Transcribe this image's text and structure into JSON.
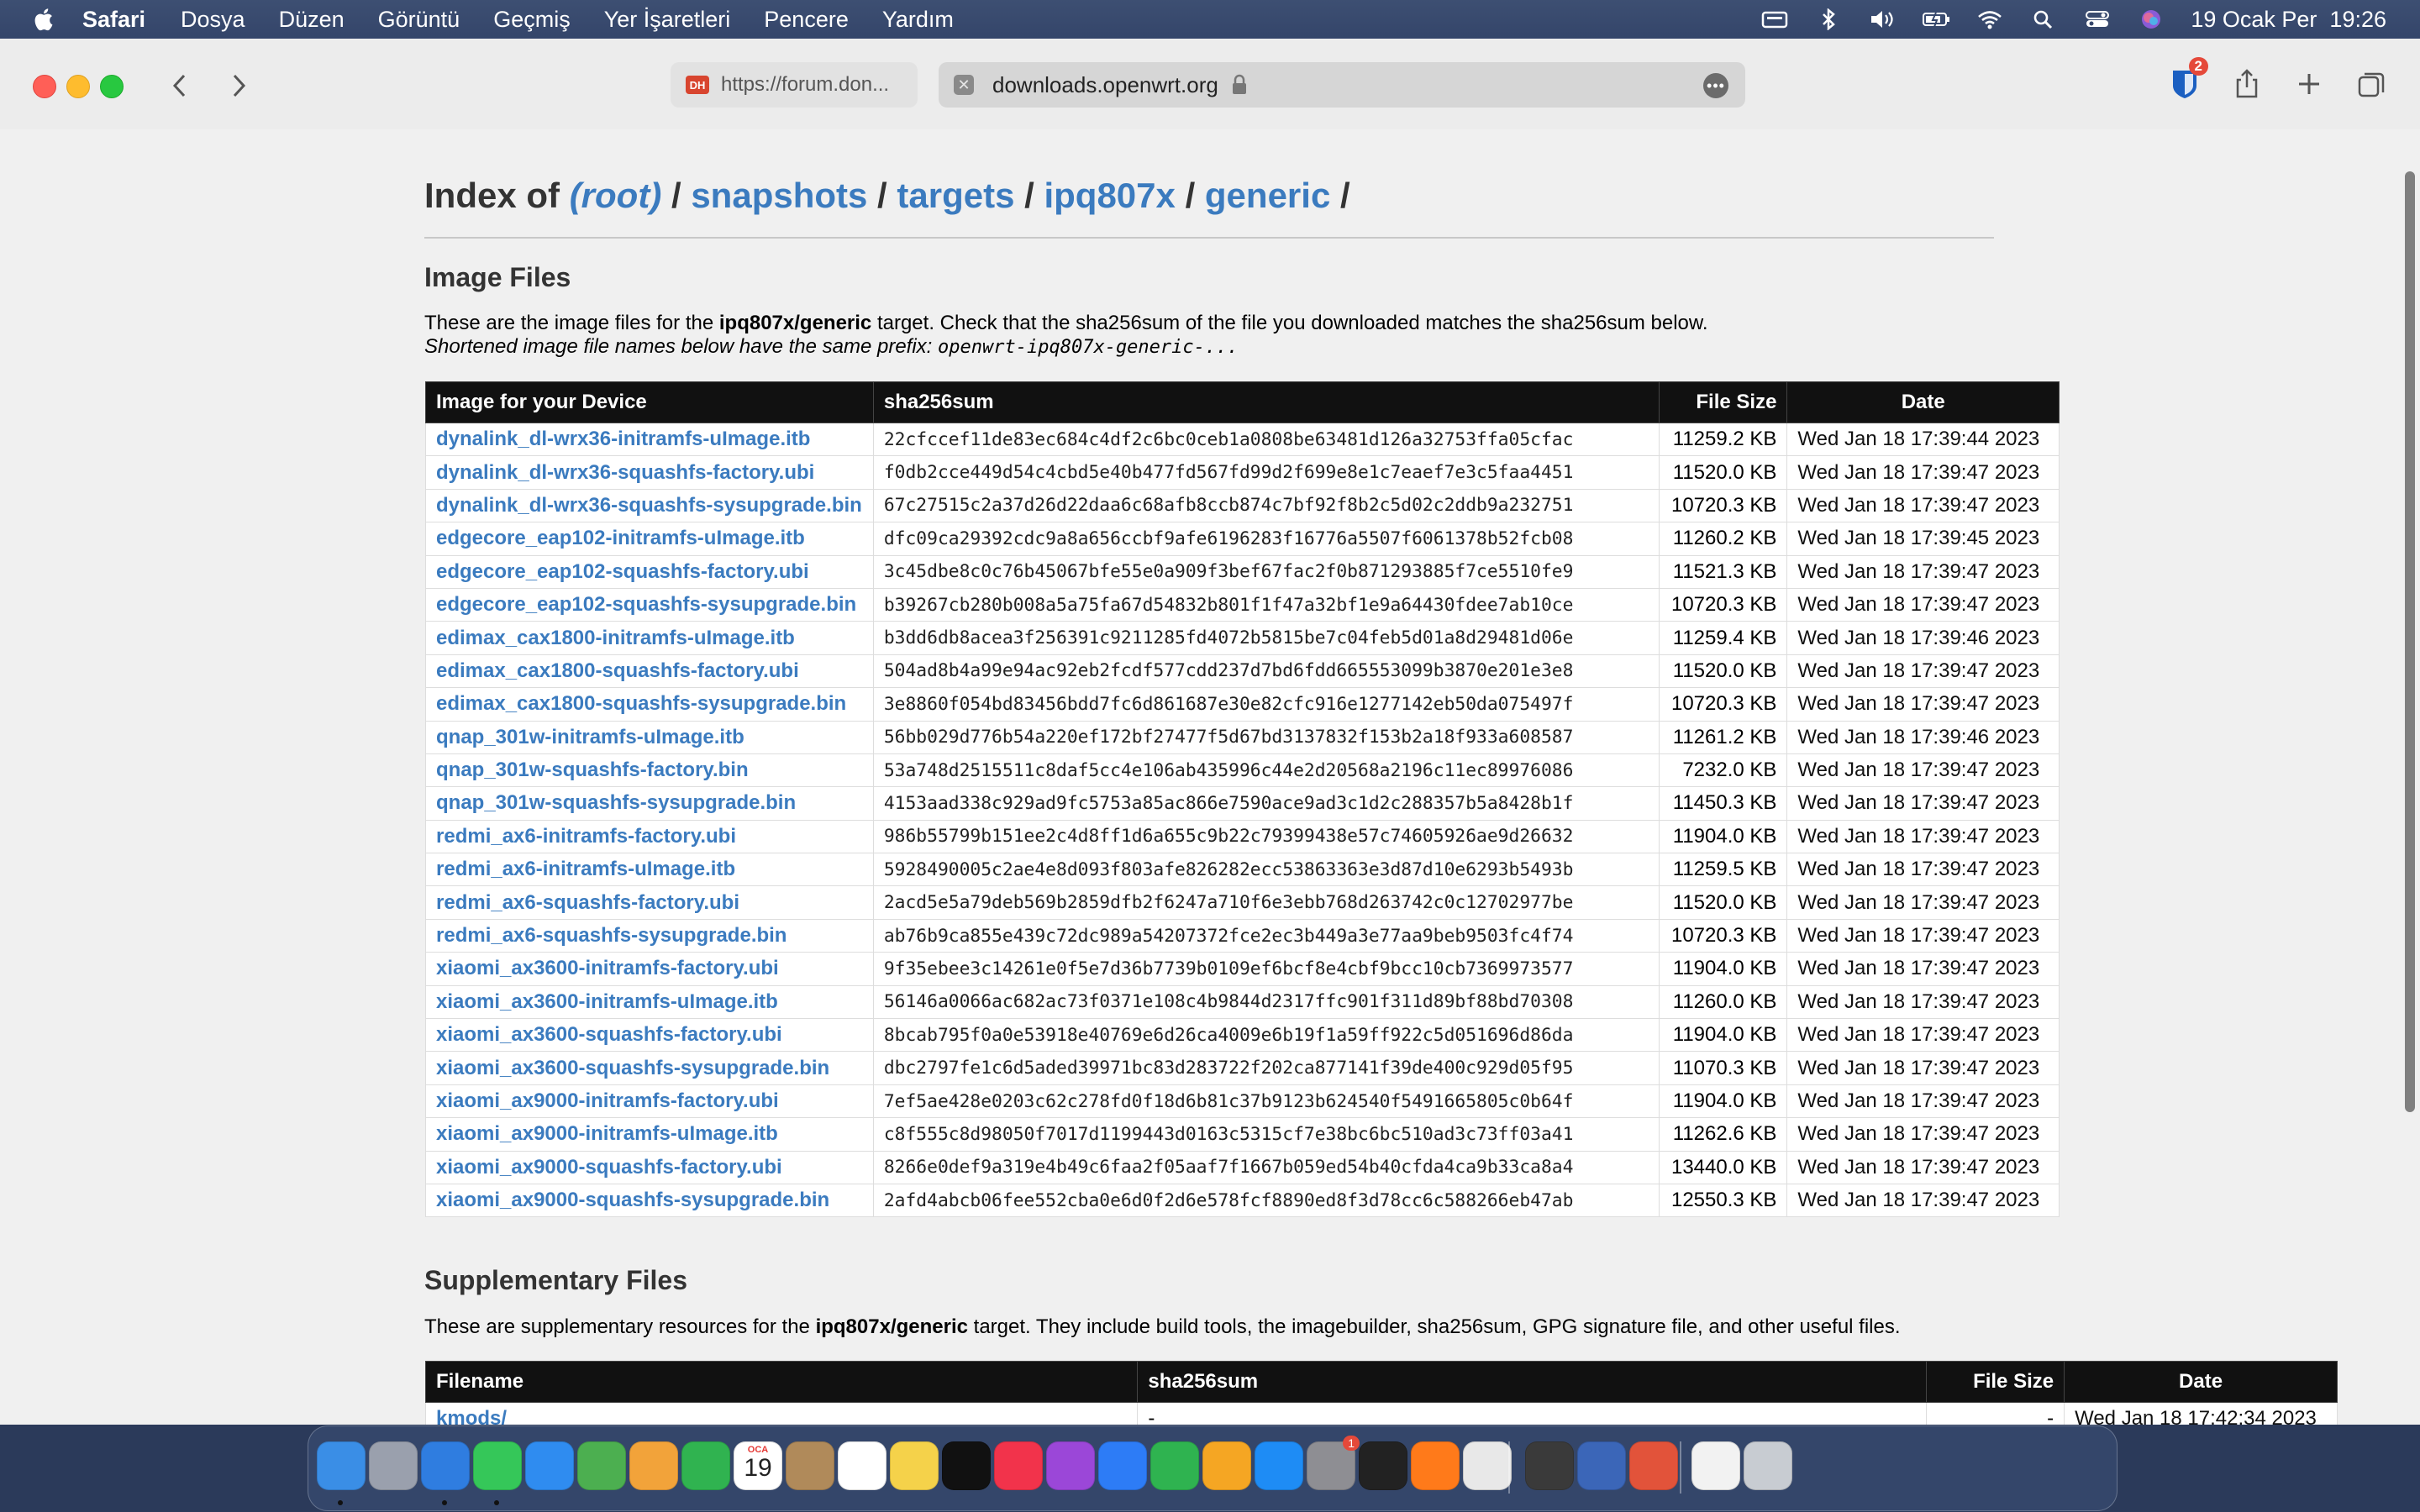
{
  "menubar": {
    "app": "Safari",
    "items": [
      "Dosya",
      "Düzen",
      "Görüntü",
      "Geçmiş",
      "Yer İşaretleri",
      "Pencere",
      "Yardım"
    ],
    "datetime": "19 Ocak Per  19:26",
    "status_icons": [
      "keyboard-icon",
      "bluetooth-icon",
      "volume-icon",
      "battery-icon",
      "wifi-icon",
      "spotlight-icon",
      "control-center-icon",
      "siri-icon"
    ]
  },
  "toolbar": {
    "tab1_favicon": "DH",
    "tab1_url": "https://forum.don...",
    "tab2_url": "downloads.openwrt.org",
    "tab2_close": "✕",
    "tab2_more": "•••",
    "bitwarden_badge": "2"
  },
  "page": {
    "index_of": "Index of",
    "crumbs": [
      "(root)",
      "snapshots",
      "targets",
      "ipq807x",
      "generic"
    ],
    "slash": "/",
    "image_heading": "Image Files",
    "image_desc_1": "These are the image files for the ",
    "image_desc_target": "ipq807x/generic",
    "image_desc_2": " target. Check that the sha256sum of the file you downloaded matches the sha256sum below.",
    "image_desc_short": "Shortened image file names below have the same prefix: ",
    "image_desc_prefix": "openwrt-ipq807x-generic-...",
    "image_table": {
      "headers": [
        "Image for your Device",
        "sha256sum",
        "File Size",
        "Date"
      ],
      "rows": [
        [
          "dynalink_dl-wrx36-initramfs-uImage.itb",
          "22cfccef11de83ec684c4df2c6bc0ceb1a0808be63481d126a32753ffa05cfac",
          "11259.2 KB",
          "Wed Jan 18 17:39:44 2023"
        ],
        [
          "dynalink_dl-wrx36-squashfs-factory.ubi",
          "f0db2cce449d54c4cbd5e40b477fd567fd99d2f699e8e1c7eaef7e3c5faa4451",
          "11520.0 KB",
          "Wed Jan 18 17:39:47 2023"
        ],
        [
          "dynalink_dl-wrx36-squashfs-sysupgrade.bin",
          "67c27515c2a37d26d22daa6c68afb8ccb874c7bf92f8b2c5d02c2ddb9a232751",
          "10720.3 KB",
          "Wed Jan 18 17:39:47 2023"
        ],
        [
          "edgecore_eap102-initramfs-uImage.itb",
          "dfc09ca29392cdc9a8a656ccbf9afe6196283f16776a5507f6061378b52fcb08",
          "11260.2 KB",
          "Wed Jan 18 17:39:45 2023"
        ],
        [
          "edgecore_eap102-squashfs-factory.ubi",
          "3c45dbe8c0c76b45067bfe55e0a909f3bef67fac2f0b871293885f7ce5510fe9",
          "11521.3 KB",
          "Wed Jan 18 17:39:47 2023"
        ],
        [
          "edgecore_eap102-squashfs-sysupgrade.bin",
          "b39267cb280b008a5a75fa67d54832b801f1f47a32bf1e9a64430fdee7ab10ce",
          "10720.3 KB",
          "Wed Jan 18 17:39:47 2023"
        ],
        [
          "edimax_cax1800-initramfs-uImage.itb",
          "b3dd6db8acea3f256391c9211285fd4072b5815be7c04feb5d01a8d29481d06e",
          "11259.4 KB",
          "Wed Jan 18 17:39:46 2023"
        ],
        [
          "edimax_cax1800-squashfs-factory.ubi",
          "504ad8b4a99e94ac92eb2fcdf577cdd237d7bd6fdd665553099b3870e201e3e8",
          "11520.0 KB",
          "Wed Jan 18 17:39:47 2023"
        ],
        [
          "edimax_cax1800-squashfs-sysupgrade.bin",
          "3e8860f054bd83456bdd7fc6d861687e30e82cfc916e1277142eb50da075497f",
          "10720.3 KB",
          "Wed Jan 18 17:39:47 2023"
        ],
        [
          "qnap_301w-initramfs-uImage.itb",
          "56bb029d776b54a220ef172bf27477f5d67bd3137832f153b2a18f933a608587",
          "11261.2 KB",
          "Wed Jan 18 17:39:46 2023"
        ],
        [
          "qnap_301w-squashfs-factory.bin",
          "53a748d2515511c8daf5cc4e106ab435996c44e2d20568a2196c11ec89976086",
          "7232.0 KB",
          "Wed Jan 18 17:39:47 2023"
        ],
        [
          "qnap_301w-squashfs-sysupgrade.bin",
          "4153aad338c929ad9fc5753a85ac866e7590ace9ad3c1d2c288357b5a8428b1f",
          "11450.3 KB",
          "Wed Jan 18 17:39:47 2023"
        ],
        [
          "redmi_ax6-initramfs-factory.ubi",
          "986b55799b151ee2c4d8ff1d6a655c9b22c79399438e57c74605926ae9d26632",
          "11904.0 KB",
          "Wed Jan 18 17:39:47 2023"
        ],
        [
          "redmi_ax6-initramfs-uImage.itb",
          "5928490005c2ae4e8d093f803afe826282ecc53863363e3d87d10e6293b5493b",
          "11259.5 KB",
          "Wed Jan 18 17:39:47 2023"
        ],
        [
          "redmi_ax6-squashfs-factory.ubi",
          "2acd5e5a79deb569b2859dfb2f6247a710f6e3ebb768d263742c0c12702977be",
          "11520.0 KB",
          "Wed Jan 18 17:39:47 2023"
        ],
        [
          "redmi_ax6-squashfs-sysupgrade.bin",
          "ab76b9ca855e439c72dc989a54207372fce2ec3b449a3e77aa9beb9503fc4f74",
          "10720.3 KB",
          "Wed Jan 18 17:39:47 2023"
        ],
        [
          "xiaomi_ax3600-initramfs-factory.ubi",
          "9f35ebee3c14261e0f5e7d36b7739b0109ef6bcf8e4cbf9bcc10cb7369973577",
          "11904.0 KB",
          "Wed Jan 18 17:39:47 2023"
        ],
        [
          "xiaomi_ax3600-initramfs-uImage.itb",
          "56146a0066ac682ac73f0371e108c4b9844d2317ffc901f311d89bf88bd70308",
          "11260.0 KB",
          "Wed Jan 18 17:39:47 2023"
        ],
        [
          "xiaomi_ax3600-squashfs-factory.ubi",
          "8bcab795f0a0e53918e40769e6d26ca4009e6b19f1a59ff922c5d051696d86da",
          "11904.0 KB",
          "Wed Jan 18 17:39:47 2023"
        ],
        [
          "xiaomi_ax3600-squashfs-sysupgrade.bin",
          "dbc2797fe1c6d5aded39971bc83d283722f202ca877141f39de400c929d05f95",
          "11070.3 KB",
          "Wed Jan 18 17:39:47 2023"
        ],
        [
          "xiaomi_ax9000-initramfs-factory.ubi",
          "7ef5ae428e0203c62c278fd0f18d6b81c37b9123b624540f5491665805c0b64f",
          "11904.0 KB",
          "Wed Jan 18 17:39:47 2023"
        ],
        [
          "xiaomi_ax9000-initramfs-uImage.itb",
          "c8f555c8d98050f7017d1199443d0163c5315cf7e38bc6bc510ad3c73ff03a41",
          "11262.6 KB",
          "Wed Jan 18 17:39:47 2023"
        ],
        [
          "xiaomi_ax9000-squashfs-factory.ubi",
          "8266e0def9a319e4b49c6faa2f05aaf7f1667b059ed54b40cfda4ca9b33ca8a4",
          "13440.0 KB",
          "Wed Jan 18 17:39:47 2023"
        ],
        [
          "xiaomi_ax9000-squashfs-sysupgrade.bin",
          "2afd4abcb06fee552cba0e6d0f2d6e578fcf8890ed8f3d78cc6c588266eb47ab",
          "12550.3 KB",
          "Wed Jan 18 17:39:47 2023"
        ]
      ]
    },
    "supp_heading": "Supplementary Files",
    "supp_desc_1": "These are supplementary resources for the ",
    "supp_desc_target": "ipq807x/generic",
    "supp_desc_2": " target. They include build tools, the imagebuilder, sha256sum, GPG signature file, and other useful files.",
    "supp_table": {
      "headers": [
        "Filename",
        "sha256sum",
        "File Size",
        "Date"
      ],
      "rows": [
        [
          "kmods/",
          "-",
          "-",
          "Wed Jan 18 17:42:34 2023"
        ]
      ]
    }
  },
  "dock": {
    "apps": [
      "finder-icon",
      "launchpad-icon",
      "safari-icon",
      "messages-icon",
      "mail-icon",
      "maps-icon",
      "photos-icon",
      "facetime-icon",
      "calendar-icon",
      "contacts-icon",
      "reminders-icon",
      "notes-icon",
      "appletv-icon",
      "music-icon",
      "podcasts-icon",
      "keynote-icon",
      "numbers-icon",
      "pages-icon",
      "appstore-icon",
      "system-settings-icon",
      "terminal-icon",
      "firefox-icon",
      "chrome-icon",
      "sublime-icon",
      "shield-app-icon",
      "git-app-icon",
      "document-icon",
      "trash-icon"
    ],
    "calendar_month": "OCA",
    "calendar_day": "19",
    "settings_badge": "1"
  }
}
